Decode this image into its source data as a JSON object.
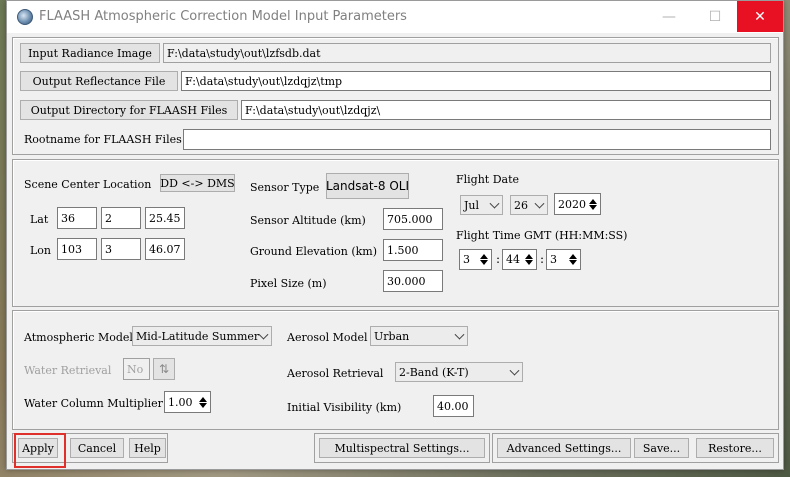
{
  "window": {
    "title": "FLAASH Atmospheric Correction Model Input Parameters",
    "minimize_glyph": "—",
    "maximize_glyph": "☐",
    "close_glyph": "✕"
  },
  "files": {
    "input_radiance_label": "Input Radiance Image",
    "input_radiance_value": "F:\\data\\study\\out\\lzfsdb.dat",
    "output_reflectance_label": "Output Reflectance File",
    "output_reflectance_value": "F:\\data\\study\\out\\lzdqjz\\tmp",
    "output_directory_label": "Output Directory for FLAASH Files",
    "output_directory_value": "F:\\data\\study\\out\\lzdqjz\\",
    "rootname_label": "Rootname for FLAASH Files",
    "rootname_value": ""
  },
  "scene": {
    "center_location_label": "Scene Center Location",
    "dd_dms_button": "DD <-> DMS",
    "lat_label": "Lat",
    "lat_deg": "36",
    "lat_min": "2",
    "lat_sec": "25.45",
    "lon_label": "Lon",
    "lon_deg": "103",
    "lon_min": "3",
    "lon_sec": "46.07"
  },
  "sensor": {
    "type_label": "Sensor Type",
    "type_value": "Landsat-8 OLI",
    "altitude_label": "Sensor Altitude (km)",
    "altitude_value": "705.000",
    "ground_elevation_label": "Ground Elevation (km)",
    "ground_elevation_value": "1.500",
    "pixel_size_label": "Pixel Size (m)",
    "pixel_size_value": "30.000"
  },
  "flight": {
    "date_label": "Flight Date",
    "month": "Jul",
    "day": "26",
    "year": "2020",
    "time_label": "Flight Time GMT (HH:MM:SS)",
    "hour": "3",
    "minute": "44",
    "second": "3",
    "separator": ":"
  },
  "atmosphere": {
    "model_label": "Atmospheric Model",
    "model_value": "Mid-Latitude Summer",
    "water_retrieval_label": "Water Retrieval",
    "water_retrieval_value": "No",
    "water_column_label": "Water Column Multiplier",
    "water_column_value": "1.00",
    "aerosol_model_label": "Aerosol Model",
    "aerosol_model_value": "Urban",
    "aerosol_retrieval_label": "Aerosol Retrieval",
    "aerosol_retrieval_value": "2-Band (K-T)",
    "visibility_label": "Initial Visibility (km)",
    "visibility_value": "40.00"
  },
  "footer": {
    "apply": "Apply",
    "cancel": "Cancel",
    "help": "Help",
    "multispectral": "Multispectral Settings...",
    "advanced": "Advanced Settings...",
    "save": "Save...",
    "restore": "Restore..."
  },
  "colors": {
    "highlight": "#e0302b",
    "close_button": "#e81123"
  }
}
